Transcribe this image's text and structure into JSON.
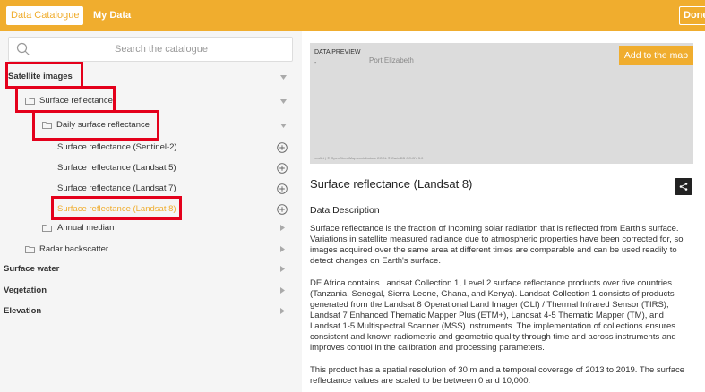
{
  "topbar": {
    "tabs": [
      {
        "label": "Data Catalogue",
        "active": true
      },
      {
        "label": "My Data",
        "active": false
      }
    ],
    "done_label": "Done"
  },
  "search": {
    "placeholder": "Search the catalogue",
    "icon": "search-icon"
  },
  "tree": {
    "satellite": "Satellite images",
    "surface_reflectance": "Surface reflectance",
    "daily": "Daily surface reflectance",
    "items": [
      "Surface reflectance (Sentinel-2)",
      "Surface reflectance (Landsat 5)",
      "Surface reflectance (Landsat 7)",
      "Surface reflectance (Landsat 8)"
    ],
    "annual_median": "Annual median",
    "radar": "Radar backscatter",
    "surface_water": "Surface water",
    "vegetation": "Vegetation",
    "elevation": "Elevation"
  },
  "preview": {
    "label": "DATA PREVIEW",
    "place": "Port Elizabeth",
    "attribution": "Leaflet | © OpenStreetMap contributors CGDL © CartoDB CC-BY 3.0",
    "add_label": "Add to the map"
  },
  "dataset": {
    "title": "Surface reflectance (Landsat 8)",
    "description_heading": "Data Description",
    "paragraphs": [
      "Surface reflectance is the fraction of incoming solar radiation that is reflected from Earth's surface. Variations in satellite measured radiance due to atmospheric properties have been corrected for, so images acquired over the same area at different times are comparable and can be used readily to detect changes on Earth's surface.",
      "DE Africa contains Landsat Collection 1, Level 2 surface reflectance products over five countries (Tanzania, Senegal, Sierra Leone, Ghana, and Kenya). Landsat Collection 1 consists of products generated from the Landsat 8 Operational Land Imager (OLI) / Thermal Infrared Sensor (TIRS), Landsat 7 Enhanced Thematic Mapper Plus (ETM+), Landsat 4-5 Thematic Mapper (TM), and Landsat 1-5 Multispectral Scanner (MSS) instruments. The implementation of collections ensures consistent and known radiometric and geometric quality through time and across instruments and improves control in the calibration and processing parameters.",
      "This product has a spatial resolution of 30 m and a temporal coverage of 2013 to 2019. The surface reflectance values are scaled to be between 0 and 10,000."
    ]
  },
  "colors": {
    "accent": "#f0ad2e",
    "highlight_box": "#e4001b"
  }
}
